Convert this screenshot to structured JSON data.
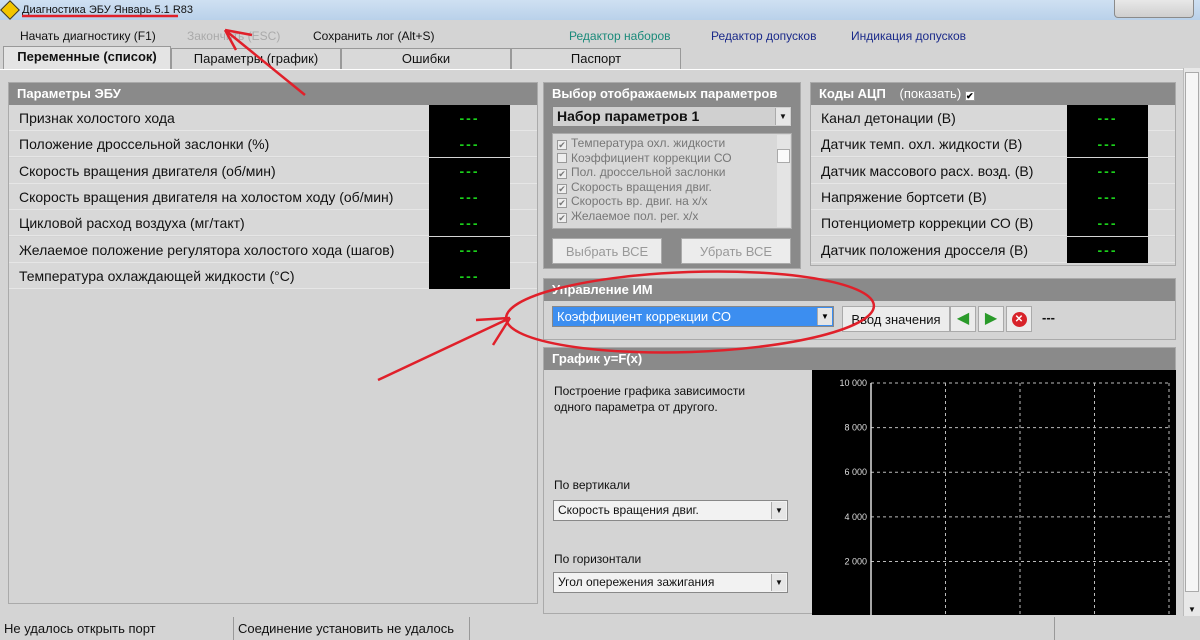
{
  "window": {
    "title": "Диагностика ЭБУ Январь 5.1 R83"
  },
  "menu": {
    "start": "Начать диагностику (F1)",
    "stop": "Закончить (ESC)",
    "save": "Сохранить лог (Alt+S)",
    "sets_editor": "Редактор наборов",
    "tol_editor": "Редактор допусков",
    "tol_indication": "Индикация допусков"
  },
  "tabs": [
    "Переменные (список)",
    "Параметры (график)",
    "Ошибки",
    "Паспорт"
  ],
  "ecu": {
    "title": "Параметры ЭБУ",
    "rows": [
      {
        "label": "Признак холостого хода",
        "value": "---"
      },
      {
        "label": "Положение дроссельной заслонки (%)",
        "value": "---"
      },
      {
        "label": "Скорость вращения двигателя (об/мин)",
        "value": "---"
      },
      {
        "label": "Скорость вращения двигателя на холостом ходу (об/мин)",
        "value": "---"
      },
      {
        "label": "Цикловой расход воздуха (мг/такт)",
        "value": "---"
      },
      {
        "label": "Желаемое положение регулятора холостого хода (шагов)",
        "value": "---"
      },
      {
        "label": "Температура охлаждающей жидкости (°С)",
        "value": "---"
      }
    ]
  },
  "select_params": {
    "title": "Выбор отображаемых параметров",
    "set": "Набор параметров 1",
    "items": [
      {
        "label": "Температура охл. жидкости",
        "checked": true
      },
      {
        "label": "Коэффициент коррекции СО",
        "checked": false
      },
      {
        "label": "Пол. дроссельной заслонки",
        "checked": true
      },
      {
        "label": "Скорость вращения двиг.",
        "checked": true
      },
      {
        "label": "Скорость вр. двиг. на х/х",
        "checked": true
      },
      {
        "label": "Желаемое пол. рег. х/х",
        "checked": true
      }
    ],
    "select_all": "Выбрать ВСЕ",
    "deselect_all": "Убрать ВСЕ"
  },
  "adc": {
    "title": "Коды АЦП",
    "show": "(показать)",
    "show_checked": true,
    "rows": [
      {
        "label": "Канал детонации (В)",
        "value": "---"
      },
      {
        "label": "Датчик темп. охл. жидкости (В)",
        "value": "---"
      },
      {
        "label": "Датчик массового расх. возд. (В)",
        "value": "---"
      },
      {
        "label": "Напряжение бортсети (В)",
        "value": "---"
      },
      {
        "label": "Потенциометр коррекции СО (В)",
        "value": "---"
      },
      {
        "label": "Датчик положения дросселя (В)",
        "value": "---"
      }
    ]
  },
  "control": {
    "title": "Управление ИМ",
    "selected": "Коэффициент коррекции СО",
    "enter": "Ввод значения",
    "value": "---"
  },
  "graph": {
    "title": "График y=F(x)",
    "desc": "Построение графика зависимости одного параметра от другого.",
    "vertical_label": "По вертикали",
    "vertical": "Скорость вращения двиг.",
    "horizontal_label": "По горизонтали",
    "horizontal": "Угол опережения зажигания"
  },
  "chart_data": {
    "type": "line",
    "title": "",
    "xlabel": "",
    "ylabel": "",
    "ylim": [
      0,
      10000
    ],
    "yticks": [
      "2 000",
      "4 000",
      "6 000",
      "8 000",
      "10 000"
    ],
    "series": [],
    "grid": true
  },
  "status": {
    "port": "Не удалось открыть порт",
    "conn": "Соединение установить не удалось"
  }
}
